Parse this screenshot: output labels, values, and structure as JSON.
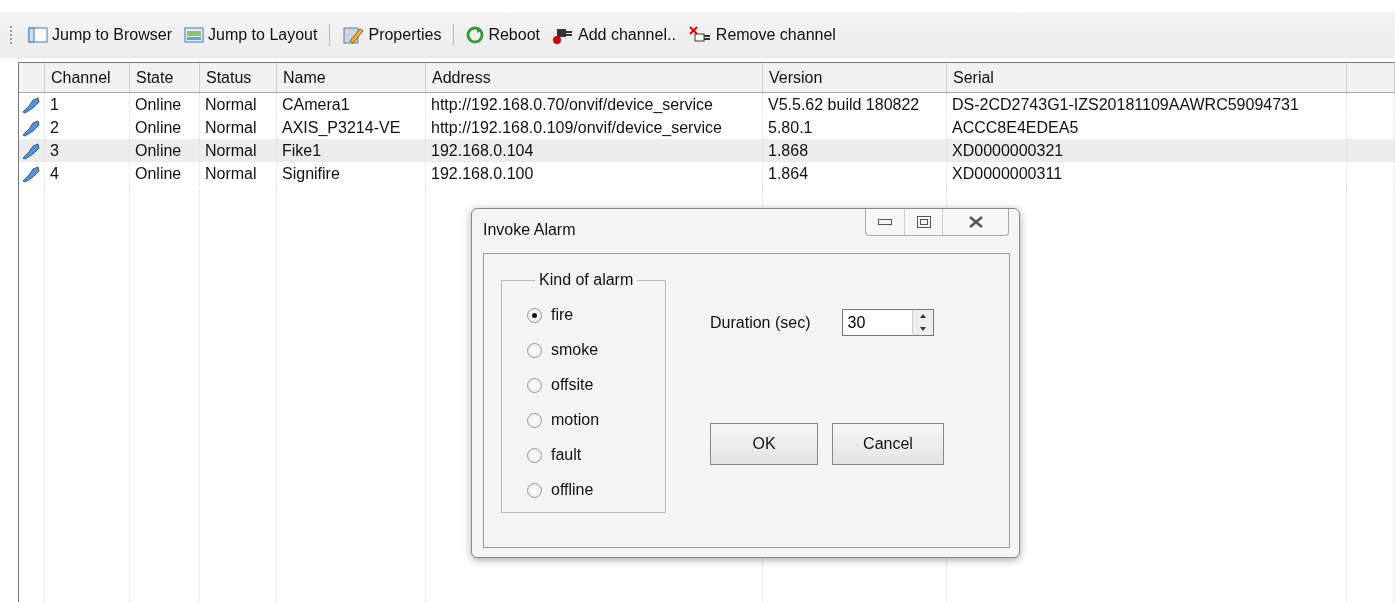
{
  "toolbar": {
    "groups": [
      {
        "items": [
          {
            "kind": "browser",
            "label": "Jump to Browser"
          },
          {
            "kind": "layout",
            "label": "Jump to Layout"
          }
        ]
      },
      {
        "items": [
          {
            "kind": "properties",
            "label": "Properties"
          }
        ]
      },
      {
        "items": [
          {
            "kind": "reboot",
            "label": "Reboot"
          },
          {
            "kind": "add",
            "label": "Add channel.."
          },
          {
            "kind": "remove",
            "label": "Remove channel"
          }
        ]
      }
    ]
  },
  "table": {
    "columns": [
      "Channel",
      "State",
      "Status",
      "Name",
      "Address",
      "Version",
      "Serial"
    ],
    "rows": [
      {
        "selected": false,
        "cells": [
          "1",
          "Online",
          "Normal",
          "CAmera1",
          "http://192.168.0.70/onvif/device_service",
          "V5.5.62 build 180822",
          "DS-2CD2743G1-IZS20181109AAWRC59094731"
        ]
      },
      {
        "selected": false,
        "cells": [
          "2",
          "Online",
          "Normal",
          "AXIS_P3214-VE",
          "http://192.168.0.109/onvif/device_service",
          "5.80.1",
          "ACCC8E4EDEA5"
        ]
      },
      {
        "selected": true,
        "cells": [
          "3",
          "Online",
          "Normal",
          "Fike1",
          "192.168.0.104",
          "1.868",
          "XD0000000321"
        ]
      },
      {
        "selected": false,
        "cells": [
          "4",
          "Online",
          "Normal",
          "Signifire",
          "192.168.0.100",
          "1.864",
          "XD0000000311"
        ]
      }
    ]
  },
  "dialog": {
    "title": "Invoke Alarm",
    "group_label": "Kind of alarm",
    "options": [
      {
        "label": "fire",
        "selected": true
      },
      {
        "label": "smoke",
        "selected": false
      },
      {
        "label": "offsite",
        "selected": false
      },
      {
        "label": "motion",
        "selected": false
      },
      {
        "label": "fault",
        "selected": false
      },
      {
        "label": "offline",
        "selected": false
      }
    ],
    "duration": {
      "label": "Duration (sec)",
      "value": "30"
    },
    "buttons": [
      "OK",
      "Cancel"
    ]
  }
}
